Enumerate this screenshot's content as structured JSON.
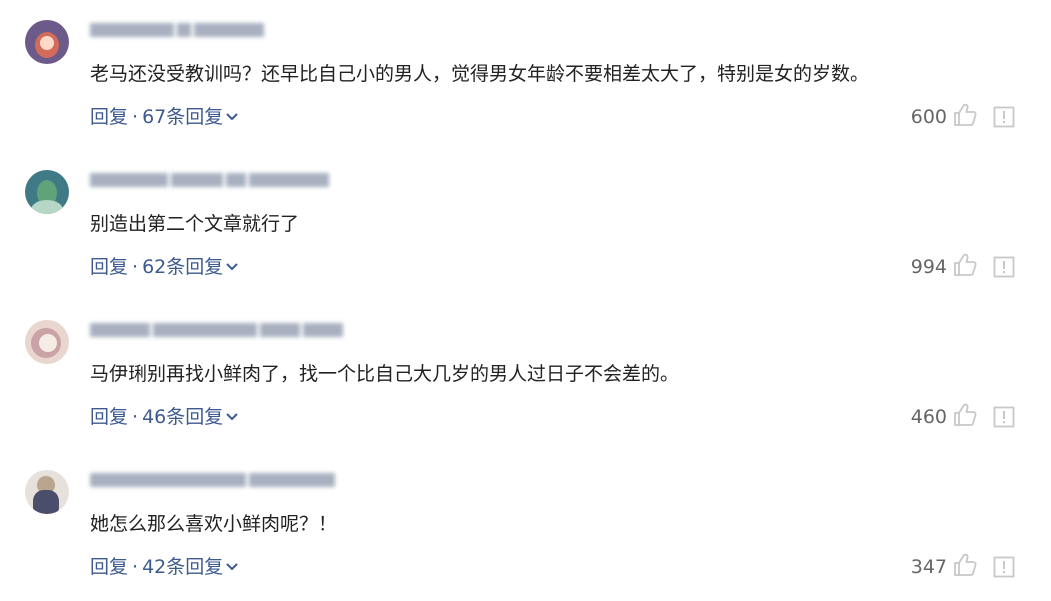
{
  "comments": [
    {
      "text": "老马还没受教训吗？还早比自己小的男人，觉得男女年龄不要相差太大了，特别是女的岁数。",
      "reply_label": "回复",
      "separator": "·",
      "replies_label": "67条回复",
      "likes": "600",
      "avatar_colors": [
        "#6b5a8a",
        "#d36b5a",
        "#ffd9c8"
      ]
    },
    {
      "text": "别造出第二个文章就行了",
      "reply_label": "回复",
      "separator": "·",
      "replies_label": "62条回复",
      "likes": "994",
      "avatar_colors": [
        "#3f7a86",
        "#5fa37a",
        "#b6d6c6"
      ]
    },
    {
      "text": "马伊琍别再找小鲜肉了，找一个比自己大几岁的男人过日子不会差的。",
      "reply_label": "回复",
      "separator": "·",
      "replies_label": "46条回复",
      "likes": "460",
      "avatar_colors": [
        "#e9d6cf",
        "#c9a3a6",
        "#f5ece6"
      ]
    },
    {
      "text": "她怎么那么喜欢小鲜肉呢？！",
      "reply_label": "回复",
      "separator": "·",
      "replies_label": "42条回复",
      "likes": "347",
      "avatar_colors": [
        "#4a4e6a",
        "#b9a58c",
        "#e6e1da"
      ]
    }
  ],
  "colors": {
    "link": "#3d5a8f",
    "text": "#222222",
    "count": "#666666",
    "icon": "#c8c8c8"
  }
}
